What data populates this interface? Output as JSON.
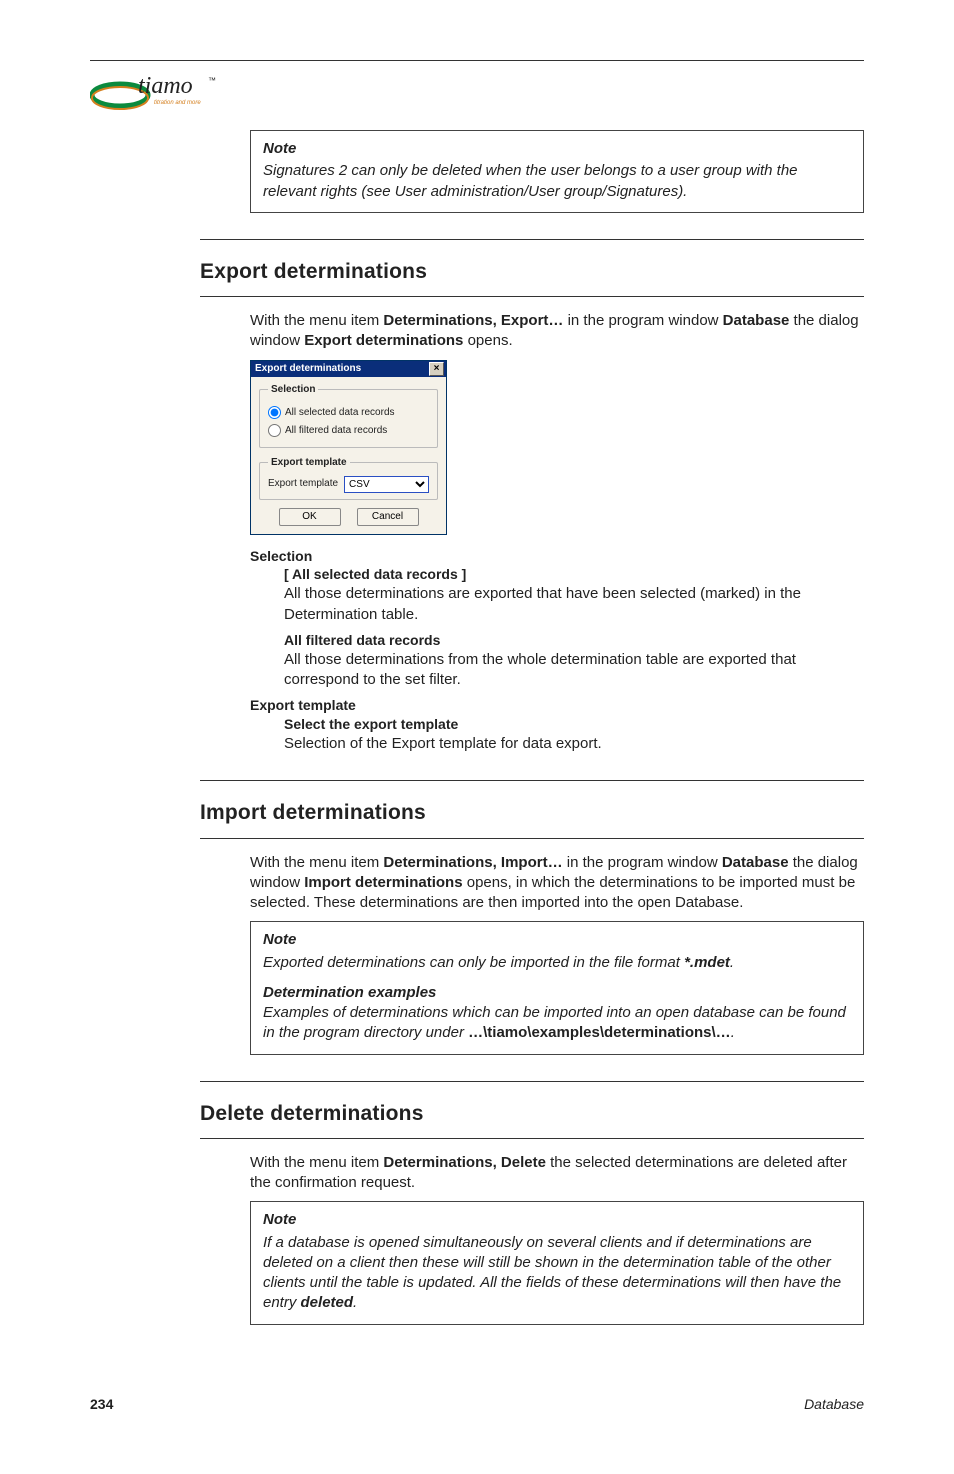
{
  "logo": {
    "brand": "tiamo",
    "tagline": "titration and more",
    "tm": "™"
  },
  "notes": {
    "top": {
      "title": "Note",
      "body": "Signatures 2 can only be deleted when the user belongs to a user group with the relevant rights (see User administration/User group/Signatures)."
    },
    "import": {
      "title": "Note",
      "body1_a": "Exported determinations can only be imported in the file format ",
      "body1_b": "*.mdet",
      "body1_c": ".",
      "sub": "Determination examples",
      "body2_a": "Examples of determinations which can be imported into an open database can be found in the program directory under ",
      "body2_b": "…\\tiamo\\examples\\determinations\\…",
      "body2_c": "."
    },
    "delete": {
      "title": "Note",
      "body_a": "If a database is opened simultaneously on several clients and if determinations are deleted on a client then these will still be shown in the determination table of the other clients until the table is updated. All the fields of these determinations will then have the entry ",
      "body_b": "deleted",
      "body_c": "."
    }
  },
  "export": {
    "heading": "Export determinations",
    "intro": {
      "a": "With the menu item ",
      "b": "Determinations, Export…",
      "c": " in the program window ",
      "d": "Database",
      "e": " the dialog window ",
      "f": "Export determinations",
      "g": " opens."
    },
    "dialog": {
      "title": "Export determinations",
      "close": "×",
      "selection_legend": "Selection",
      "radio1": "All selected data records",
      "radio2": "All filtered data records",
      "template_legend": "Export template",
      "template_label": "Export template",
      "template_value": "CSV",
      "ok": "OK",
      "cancel": "Cancel"
    },
    "defs": {
      "sel_head": "Selection",
      "sel_sub1_title": "[ All selected data records ]",
      "sel_sub1_body": "All those determinations are exported that have been selected (marked) in the Determination table.",
      "sel_sub2_title": "All filtered data records",
      "sel_sub2_body": "All those determinations from the whole determination table are exported that correspond to the set filter.",
      "tmpl_head": "Export template",
      "tmpl_sub_title": "Select the export template",
      "tmpl_sub_body": "Selection of the Export template for data export."
    }
  },
  "import": {
    "heading": "Import determinations",
    "intro": {
      "a": "With the menu item ",
      "b": "Determinations, Import…",
      "c": " in the program window ",
      "d": "Database",
      "e": " the dialog window ",
      "f": "Import determinations",
      "g": " opens, in which the determinations to be imported must be selected. These determinations are then imported into the open Database."
    }
  },
  "delete": {
    "heading": "Delete determinations",
    "intro": {
      "a": "With the menu item ",
      "b": "Determinations, Delete",
      "c": " the selected determinations are deleted after the confirmation request."
    }
  },
  "footer": {
    "page": "234",
    "section": "Database"
  }
}
